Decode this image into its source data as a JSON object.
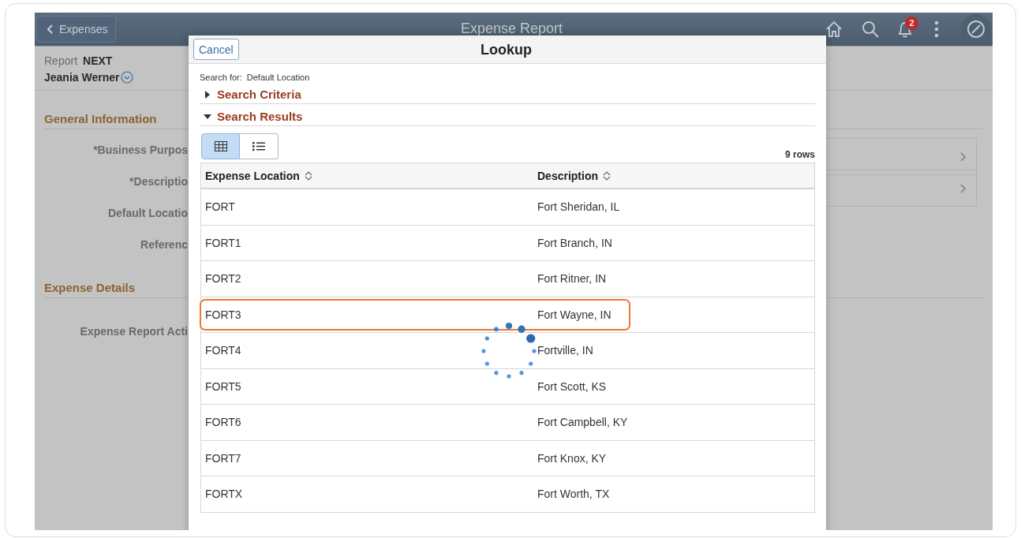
{
  "header": {
    "back_button": "Expenses",
    "title": "Expense Report",
    "notification_count": "2"
  },
  "report": {
    "label": "Report",
    "value": "NEXT",
    "employee": "Jeania Werner"
  },
  "sections": [
    {
      "title": "General Information",
      "fields": [
        {
          "label": "*Business Purpos",
          "kind": "select"
        },
        {
          "label": "*Descriptio",
          "kind": "select"
        },
        {
          "label": "Default Locatio",
          "kind": "text"
        },
        {
          "label": "Referenc",
          "kind": "text"
        }
      ]
    },
    {
      "title": "Expense Details",
      "fields": [
        {
          "label": "Expense Report Acti",
          "kind": "text"
        }
      ]
    }
  ],
  "lookup": {
    "cancel": "Cancel",
    "title": "Lookup",
    "search_for_label": "Search for:",
    "search_for_value": "Default Location",
    "groups": [
      {
        "title": "Search Criteria",
        "expanded": false
      },
      {
        "title": "Search Results",
        "expanded": true
      }
    ],
    "view_toggle": [
      {
        "kind": "grid",
        "selected": true
      },
      {
        "kind": "list",
        "selected": false
      }
    ],
    "row_count": "9 rows",
    "table": {
      "columns": [
        "Expense Location",
        "Description"
      ],
      "rows": [
        {
          "cells": [
            "FORT",
            "Fort Sheridan, IL"
          ],
          "highlighted": false
        },
        {
          "cells": [
            "FORT1",
            "Fort Branch, IN"
          ],
          "highlighted": false
        },
        {
          "cells": [
            "FORT2",
            "Fort Ritner, IN"
          ],
          "highlighted": false
        },
        {
          "cells": [
            "FORT3",
            "Fort Wayne, IN"
          ],
          "highlighted": true
        },
        {
          "cells": [
            "FORT4",
            "Fortville, IN"
          ],
          "highlighted": false
        },
        {
          "cells": [
            "FORT5",
            "Fort Scott, KS"
          ],
          "highlighted": false
        },
        {
          "cells": [
            "FORT6",
            "Fort Campbell, KY"
          ],
          "highlighted": false
        },
        {
          "cells": [
            "FORT7",
            "Fort Knox, KY"
          ],
          "highlighted": false
        },
        {
          "cells": [
            "FORTX",
            "Fort Worth, TX"
          ],
          "highlighted": false
        }
      ]
    },
    "loading": true
  }
}
